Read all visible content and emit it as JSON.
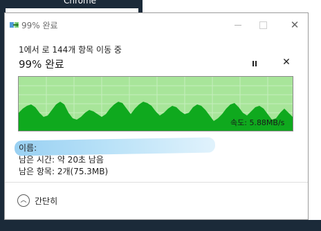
{
  "background": {
    "top_text": "Chrome"
  },
  "dialog": {
    "title": "99% 완료",
    "icons": {
      "app": "file-move-icon",
      "minimize": "minimize-icon",
      "maximize": "maximize-icon",
      "close": "close-icon"
    }
  },
  "progress": {
    "subhead": "1에서            로 144개 항목 이동 중",
    "percent_label": "99% 완료",
    "percent_value": 0.99,
    "pause_icon": "pause-icon",
    "cancel_label": "✕"
  },
  "graph": {
    "speed_label": "속도: 5.88MB/s",
    "fill_color": "#0fa91e",
    "bg_color": "#a8e59a"
  },
  "details": {
    "name_label": "이름: ",
    "time_label": "남은 시간: 약 20초 남음",
    "items_label": "남은 항목: 2개(75.3MB)"
  },
  "footer": {
    "collapse_label": "간단히",
    "collapse_icon": "chevron-up-icon"
  }
}
